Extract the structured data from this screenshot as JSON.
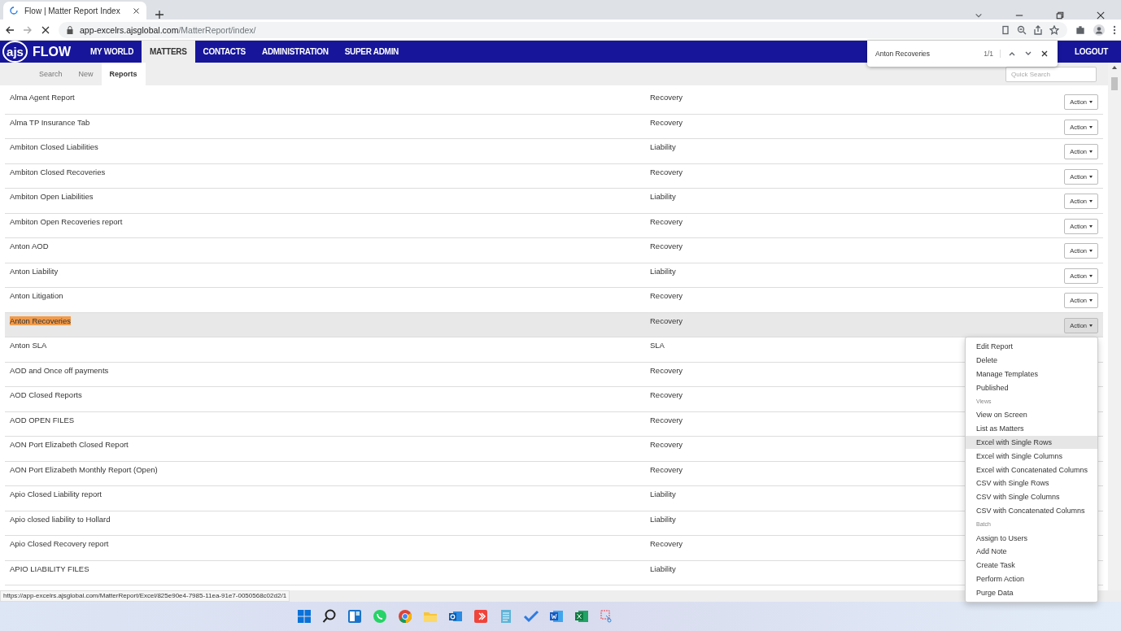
{
  "browser": {
    "tab_title": "Flow | Matter Report Index",
    "url_host": "app-excelrs.ajsglobal.com",
    "url_path": "/MatterReport/index/"
  },
  "find_bar": {
    "query": "Anton Recoveries",
    "count": "1/1"
  },
  "nav": {
    "logo": "ajs",
    "brand": "FLOW",
    "items": [
      {
        "label": "MY WORLD",
        "selected": false
      },
      {
        "label": "MATTERS",
        "selected": true
      },
      {
        "label": "CONTACTS",
        "selected": false
      },
      {
        "label": "ADMINISTRATION",
        "selected": false
      },
      {
        "label": "SUPER ADMIN",
        "selected": false
      }
    ],
    "logout": "LOGOUT"
  },
  "subnav": {
    "tabs": [
      {
        "label": "Search",
        "selected": false
      },
      {
        "label": "New",
        "selected": false
      },
      {
        "label": "Reports",
        "selected": true
      }
    ],
    "quick_search": {
      "placeholder": "Quick Search"
    }
  },
  "rows": [
    {
      "name": "Alma Agent Report",
      "type": "Recovery",
      "action": "Action",
      "selected": false,
      "match": false
    },
    {
      "name": "Alma TP Insurance Tab",
      "type": "Recovery",
      "action": "Action",
      "selected": false,
      "match": false
    },
    {
      "name": "Ambiton Closed Liabilities",
      "type": "Liability",
      "action": "Action",
      "selected": false,
      "match": false
    },
    {
      "name": "Ambiton Closed Recoveries",
      "type": "Recovery",
      "action": "Action",
      "selected": false,
      "match": false
    },
    {
      "name": "Ambiton Open Liabilities",
      "type": "Liability",
      "action": "Action",
      "selected": false,
      "match": false
    },
    {
      "name": "Ambiton Open Recoveries report",
      "type": "Recovery",
      "action": "Action",
      "selected": false,
      "match": false
    },
    {
      "name": "Anton AOD",
      "type": "Recovery",
      "action": "Action",
      "selected": false,
      "match": false
    },
    {
      "name": "Anton Liability",
      "type": "Liability",
      "action": "Action",
      "selected": false,
      "match": false
    },
    {
      "name": "Anton Litigation",
      "type": "Recovery",
      "action": "Action",
      "selected": false,
      "match": false
    },
    {
      "name": "Anton Recoveries",
      "type": "Recovery",
      "action": "Action",
      "selected": true,
      "match": true
    },
    {
      "name": "Anton SLA",
      "type": "SLA",
      "selected": false,
      "match": false
    },
    {
      "name": "AOD and Once off payments",
      "type": "Recovery",
      "selected": false,
      "match": false
    },
    {
      "name": "AOD Closed Reports",
      "type": "Recovery",
      "selected": false,
      "match": false
    },
    {
      "name": "AOD OPEN FILES",
      "type": "Recovery",
      "selected": false,
      "match": false
    },
    {
      "name": "AON Port Elizabeth Closed Report",
      "type": "Recovery",
      "selected": false,
      "match": false
    },
    {
      "name": "AON Port Elizabeth Monthly Report (Open)",
      "type": "Recovery",
      "selected": false,
      "match": false
    },
    {
      "name": "Apio Closed Liability report",
      "type": "Liability",
      "selected": false,
      "match": false
    },
    {
      "name": "Apio closed liability to Hollard",
      "type": "Liability",
      "selected": false,
      "match": false
    },
    {
      "name": "Apio Closed Recovery report",
      "type": "Recovery",
      "selected": false,
      "match": false
    },
    {
      "name": "APIO LIABILITY FILES",
      "type": "Liability",
      "selected": false,
      "match": false
    }
  ],
  "action_menu": [
    {
      "kind": "item",
      "label": "Edit Report",
      "selected": false
    },
    {
      "kind": "item",
      "label": "Delete",
      "selected": false
    },
    {
      "kind": "item",
      "label": "Manage Templates",
      "selected": false
    },
    {
      "kind": "item",
      "label": "Published",
      "selected": false
    },
    {
      "kind": "header",
      "label": "Views"
    },
    {
      "kind": "item",
      "label": "View on Screen",
      "selected": false
    },
    {
      "kind": "item",
      "label": "List as Matters",
      "selected": false
    },
    {
      "kind": "item",
      "label": "Excel with Single Rows",
      "selected": true
    },
    {
      "kind": "item",
      "label": "Excel with Single Columns",
      "selected": false
    },
    {
      "kind": "item",
      "label": "Excel with Concatenated Columns",
      "selected": false
    },
    {
      "kind": "item",
      "label": "CSV with Single Rows",
      "selected": false
    },
    {
      "kind": "item",
      "label": "CSV with Single Columns",
      "selected": false
    },
    {
      "kind": "item",
      "label": "CSV with Concatenated Columns",
      "selected": false
    },
    {
      "kind": "header",
      "label": "Batch"
    },
    {
      "kind": "item",
      "label": "Assign to Users",
      "selected": false
    },
    {
      "kind": "item",
      "label": "Add Note",
      "selected": false
    },
    {
      "kind": "item",
      "label": "Create Task",
      "selected": false
    },
    {
      "kind": "item",
      "label": "Perform Action",
      "selected": false
    },
    {
      "kind": "item",
      "label": "Purge Data",
      "selected": false
    }
  ],
  "status_url": "https://app-excelrs.ajsglobal.com/MatterReport/Excel/825e90e4-7985-11ea-91e7-0050568c02d2/1",
  "taskbar": [
    {
      "kind": "start"
    },
    {
      "kind": "search"
    },
    {
      "kind": "widgets"
    },
    {
      "kind": "whatsapp"
    },
    {
      "kind": "chrome"
    },
    {
      "kind": "folder"
    },
    {
      "kind": "outlook"
    },
    {
      "kind": "anydesk"
    },
    {
      "kind": "notepad"
    },
    {
      "kind": "todo"
    },
    {
      "kind": "word"
    },
    {
      "kind": "excel"
    },
    {
      "kind": "snip"
    }
  ]
}
